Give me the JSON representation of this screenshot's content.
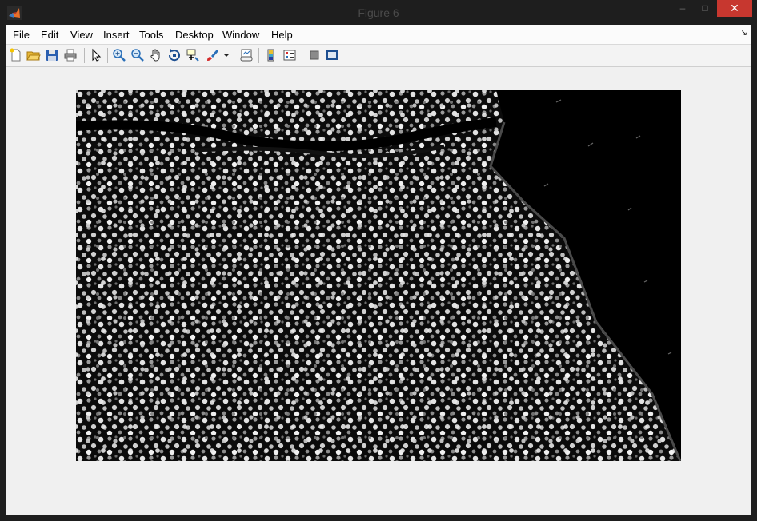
{
  "window": {
    "title": "Figure 6"
  },
  "window_controls": {
    "minimize": "–",
    "maximize": "□",
    "close": "✕"
  },
  "menu": {
    "items": [
      "File",
      "Edit",
      "View",
      "Insert",
      "Tools",
      "Desktop",
      "Window",
      "Help"
    ],
    "more": "↘"
  },
  "toolbar": {
    "buttons": [
      "new-figure-icon",
      "open-file-icon",
      "save-icon",
      "print-icon",
      "edit-plot-arrow-icon",
      "zoom-in-icon",
      "zoom-out-icon",
      "pan-hand-icon",
      "rotate-3d-icon",
      "data-cursor-icon",
      "brush-icon",
      "brush-dropdown-icon",
      "link-plot-icon",
      "insert-colorbar-icon",
      "insert-legend-icon",
      "hide-plot-tools-icon",
      "show-plot-tools-icon"
    ]
  },
  "image": {
    "description_kind": "grayscale fluorescence micrograph of tissue with cell nuclei",
    "background": "#000000"
  }
}
